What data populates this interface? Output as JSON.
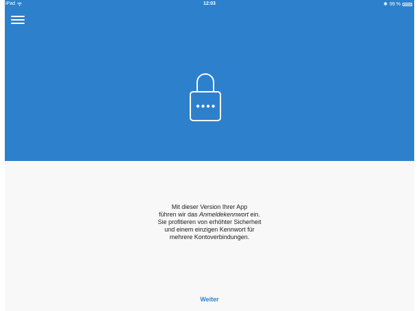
{
  "status_bar": {
    "device": "iPad",
    "time": "12:03",
    "battery": "99 %",
    "battery_level": 0.99,
    "icons": [
      "wifi-icon",
      "bluetooth-icon",
      "battery-icon"
    ]
  },
  "header": {
    "menu_icon": "hamburger-menu-icon",
    "hero_icon": "lock-icon"
  },
  "intro": {
    "line1": "Mit dieser Version Ihrer App",
    "line2_before": "führen wir das ",
    "line2_emphasis": "Anmeldekennwort",
    "line2_after": " ein.",
    "line3": "Sie profitieren von erhöhter Sicherheit",
    "line4": "und einem einzigen Kennwort für",
    "line5": "mehrere Kontoverbindungen."
  },
  "actions": {
    "continue_label": "Weiter"
  },
  "colors": {
    "accent": "#2d80cc",
    "background": "#f8f8f8",
    "text": "#1a1a1a"
  }
}
